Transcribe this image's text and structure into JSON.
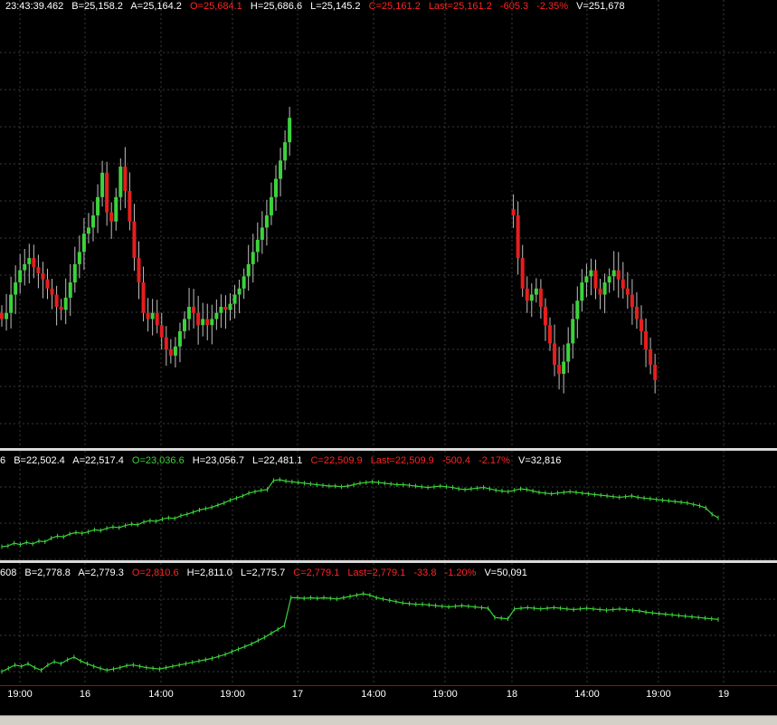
{
  "panes": [
    {
      "fields": [
        {
          "text": "23:43:39.462",
          "color": "white"
        },
        {
          "text": "B=25,158.2",
          "color": "white"
        },
        {
          "text": "A=25,164.2",
          "color": "white"
        },
        {
          "text": "O=25,684.1",
          "color": "red"
        },
        {
          "text": "H=25,686.6",
          "color": "white"
        },
        {
          "text": "L=25,145.2",
          "color": "white"
        },
        {
          "text": "C=25,161.2",
          "color": "red"
        },
        {
          "text": "Last=25,161.2",
          "color": "red"
        },
        {
          "text": "-605.3",
          "color": "red"
        },
        {
          "text": "-2.35%",
          "color": "red"
        },
        {
          "text": "V=251,678",
          "color": "white"
        }
      ]
    },
    {
      "fields": [
        {
          "text": "6",
          "color": "white"
        },
        {
          "text": "B=22,502.4",
          "color": "white"
        },
        {
          "text": "A=22,517.4",
          "color": "white"
        },
        {
          "text": "O=23,036.6",
          "color": "green"
        },
        {
          "text": "H=23,056.7",
          "color": "white"
        },
        {
          "text": "L=22,481.1",
          "color": "white"
        },
        {
          "text": "C=22,509.9",
          "color": "red"
        },
        {
          "text": "Last=22,509.9",
          "color": "red"
        },
        {
          "text": "-500.4",
          "color": "red"
        },
        {
          "text": "-2.17%",
          "color": "red"
        },
        {
          "text": "V=32,816",
          "color": "white"
        }
      ]
    },
    {
      "fields": [
        {
          "text": "608",
          "color": "white"
        },
        {
          "text": "B=2,778.8",
          "color": "white"
        },
        {
          "text": "A=2,779.3",
          "color": "white"
        },
        {
          "text": "O=2,810.6",
          "color": "red"
        },
        {
          "text": "H=2,811.0",
          "color": "white"
        },
        {
          "text": "L=2,775.7",
          "color": "white"
        },
        {
          "text": "C=2,779.1",
          "color": "red"
        },
        {
          "text": "Last=2,779.1",
          "color": "red"
        },
        {
          "text": "-33.8",
          "color": "red"
        },
        {
          "text": "-1.20%",
          "color": "red"
        },
        {
          "text": "V=50,091",
          "color": "white"
        }
      ]
    }
  ],
  "time_axis": {
    "ticks": [
      "19:00",
      "16",
      "14:00",
      "19:00",
      "17",
      "14:00",
      "19:00",
      "18",
      "14:00",
      "19:00",
      "19"
    ]
  },
  "colors": {
    "background": "#000000",
    "up": "#3cd23c",
    "down": "#e61e1e",
    "grid": "#3a3a3a",
    "axis_line": "#c00000",
    "wick": "#bfbfbf"
  },
  "chart_data": [
    {
      "type": "candlestick",
      "segments": [
        {
          "start_index": 0,
          "closes": [
            25300,
            25320,
            25380,
            25420,
            25460,
            25480,
            25500,
            25470,
            25450,
            25430,
            25400,
            25380,
            25340,
            25330,
            25370,
            25420,
            25480,
            25520,
            25580,
            25600,
            25640,
            25700,
            25780,
            25650,
            25620,
            25700,
            25800,
            25720,
            25620,
            25500,
            25420,
            25320,
            25300,
            25320,
            25280,
            25240,
            25200,
            25180,
            25210,
            25260,
            25300,
            25340,
            25320,
            25280,
            25300,
            25280,
            25300,
            25320,
            25340,
            25330,
            25350,
            25380,
            25400,
            25440,
            25480,
            25520,
            25560,
            25600,
            25640,
            25700,
            25760,
            25820,
            25880,
            25960
          ]
        },
        {
          "start_index": 112,
          "closes": [
            25640,
            25500,
            25400,
            25360,
            25380,
            25400,
            25340,
            25280,
            25220,
            25150,
            25120,
            25160,
            25220,
            25300,
            25360,
            25420,
            25440,
            25460,
            25400,
            25380,
            25420,
            25440,
            25460,
            25430,
            25400,
            25380,
            25340,
            25300,
            25260,
            25200,
            25150,
            25100
          ]
        }
      ],
      "bar_count": 160
    },
    {
      "type": "line",
      "series": [
        {
          "values": [
            22100,
            22110,
            22150,
            22130,
            22160,
            22140,
            22180,
            22170,
            22220,
            22250,
            22240,
            22280,
            22300,
            22290,
            22310,
            22340,
            22330,
            22360,
            22380,
            22370,
            22400,
            22420,
            22410,
            22450,
            22470,
            22460,
            22490,
            22510,
            22500,
            22540,
            22560,
            22590,
            22620,
            22640,
            22660,
            22690,
            22720,
            22760,
            22790,
            22820,
            22860,
            22880,
            22900,
            22910,
            23040,
            23050,
            23030,
            23020,
            23010,
            23000,
            22990,
            22980,
            22970,
            22960,
            22960,
            22950,
            22960,
            22980,
            23000,
            23010,
            23020,
            23010,
            23000,
            22990,
            22980,
            22980,
            22970,
            22960,
            22950,
            22940,
            22950,
            22960,
            22950,
            22940,
            22920,
            22910,
            22920,
            22930,
            22940,
            22920,
            22900,
            22890,
            22880,
            22900,
            22920,
            22910,
            22890,
            22870,
            22860,
            22850,
            22860,
            22870,
            22880,
            22870,
            22860,
            22850,
            22840,
            22830,
            22820,
            22810,
            22800,
            22810,
            22820,
            22800,
            22790,
            22780,
            22770,
            22760,
            22750,
            22740,
            22730,
            22720,
            22700,
            22680,
            22650,
            22560,
            22510
          ]
        }
      ]
    },
    {
      "type": "line",
      "series": [
        {
          "values": [
            2700,
            2705,
            2710,
            2708,
            2712,
            2706,
            2702,
            2710,
            2715,
            2712,
            2718,
            2722,
            2716,
            2712,
            2708,
            2705,
            2702,
            2704,
            2706,
            2709,
            2710,
            2708,
            2706,
            2705,
            2704,
            2706,
            2708,
            2710,
            2712,
            2714,
            2716,
            2718,
            2720,
            2723,
            2726,
            2730,
            2734,
            2738,
            2742,
            2747,
            2752,
            2758,
            2764,
            2770,
            2812,
            2812,
            2811,
            2812,
            2811,
            2812,
            2811,
            2810,
            2812,
            2814,
            2816,
            2818,
            2816,
            2812,
            2810,
            2808,
            2806,
            2804,
            2803,
            2802,
            2802,
            2801,
            2800,
            2799,
            2798,
            2799,
            2800,
            2799,
            2798,
            2797,
            2796,
            2782,
            2781,
            2780,
            2795,
            2796,
            2797,
            2796,
            2795,
            2796,
            2797,
            2796,
            2795,
            2794,
            2795,
            2796,
            2795,
            2794,
            2793,
            2794,
            2795,
            2794,
            2793,
            2792,
            2790,
            2789,
            2788,
            2787,
            2786,
            2785,
            2784,
            2783,
            2782,
            2781,
            2780,
            2779
          ]
        }
      ]
    }
  ]
}
